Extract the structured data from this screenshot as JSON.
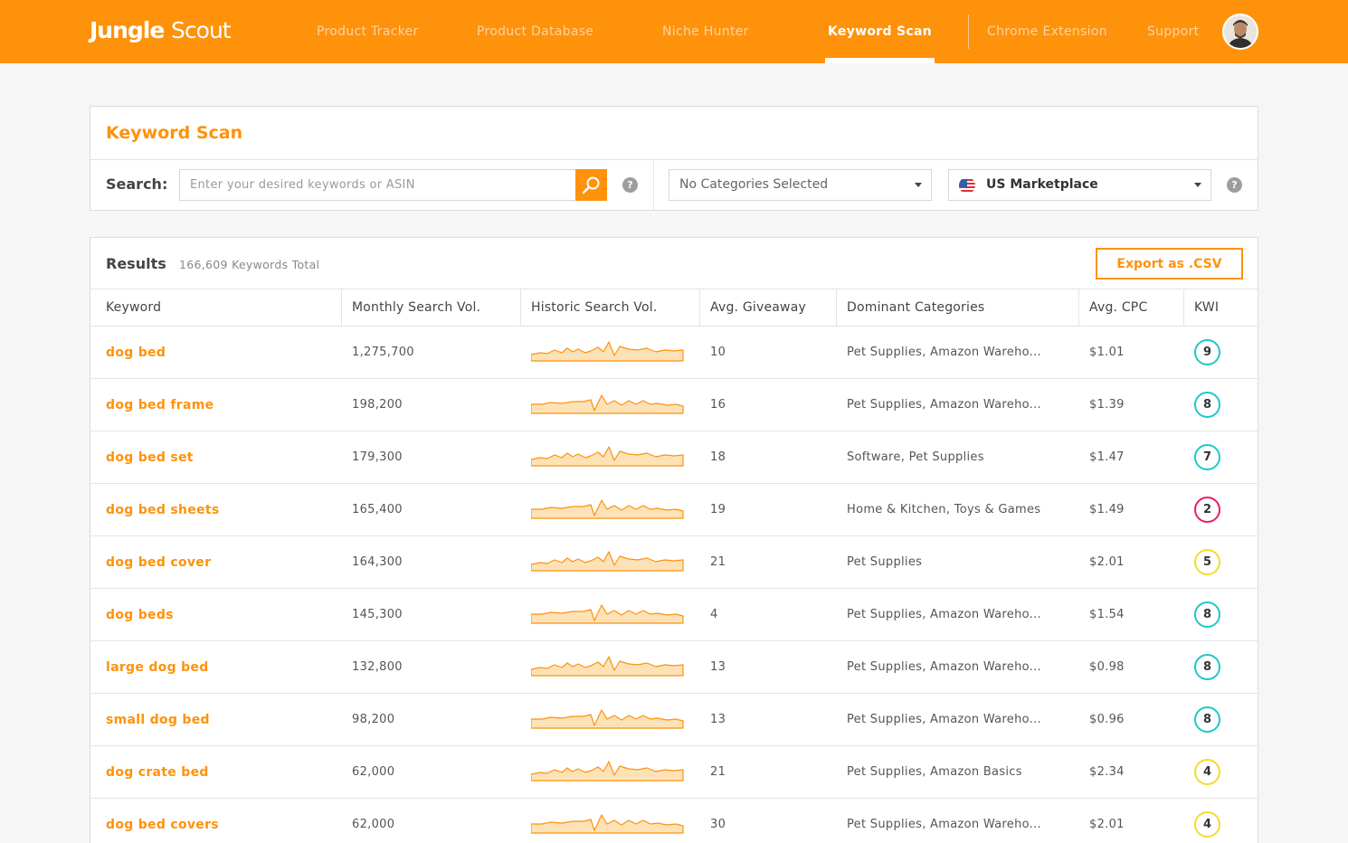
{
  "brand": {
    "logo_bold": "Jungle",
    "logo_light": "Scout"
  },
  "nav": {
    "items": [
      {
        "label": "Product Tracker",
        "active": false
      },
      {
        "label": "Product Database",
        "active": false
      },
      {
        "label": "Niche Hunter",
        "active": false
      },
      {
        "label": "Keyword Scan",
        "active": true
      },
      {
        "label": "Chrome Extension",
        "active": false
      },
      {
        "label": "Support",
        "active": false
      }
    ],
    "avatar_icon": "user-avatar"
  },
  "scan": {
    "title": "Keyword Scan",
    "search_label": "Search:",
    "search_placeholder": "Enter your desired keywords or ASIN",
    "search_icon": "magnifier-icon",
    "help_glyph": "?",
    "category_select": "No Categories Selected",
    "marketplace_select": "US Marketplace",
    "marketplace_flag": "us-flag-icon"
  },
  "results": {
    "label": "Results",
    "total": "166,609 Keywords Total",
    "export_label": "Export as .CSV",
    "columns": [
      "Keyword",
      "Monthly Search Vol.",
      "Historic Search Vol.",
      "Avg. Giveaway",
      "Dominant Categories",
      "Avg. CPC",
      "KWI"
    ],
    "rows": [
      {
        "keyword": "dog bed",
        "monthly": "1,275,700",
        "giveaway": "10",
        "categories": "Pet Supplies, Amazon Wareho...",
        "cpc": "$1.01",
        "kwi": "9",
        "kwi_color": "#1fc8c6",
        "trend": "a"
      },
      {
        "keyword": "dog bed frame",
        "monthly": "198,200",
        "giveaway": "16",
        "categories": "Pet Supplies, Amazon Wareho...",
        "cpc": "$1.39",
        "kwi": "8",
        "kwi_color": "#1fc8c6",
        "trend": "b"
      },
      {
        "keyword": "dog bed set",
        "monthly": "179,300",
        "giveaway": "18",
        "categories": "Software, Pet Supplies",
        "cpc": "$1.47",
        "kwi": "7",
        "kwi_color": "#1fc8c6",
        "trend": "a"
      },
      {
        "keyword": "dog bed sheets",
        "monthly": "165,400",
        "giveaway": "19",
        "categories": "Home & Kitchen, Toys & Games",
        "cpc": "$1.49",
        "kwi": "2",
        "kwi_color": "#e8215f",
        "trend": "b"
      },
      {
        "keyword": "dog bed cover",
        "monthly": "164,300",
        "giveaway": "21",
        "categories": "Pet Supplies",
        "cpc": "$2.01",
        "kwi": "5",
        "kwi_color": "#f3dc2c",
        "trend": "a"
      },
      {
        "keyword": "dog beds",
        "monthly": "145,300",
        "giveaway": "4",
        "categories": "Pet Supplies, Amazon Wareho...",
        "cpc": "$1.54",
        "kwi": "8",
        "kwi_color": "#1fc8c6",
        "trend": "b"
      },
      {
        "keyword": "large dog bed",
        "monthly": "132,800",
        "giveaway": "13",
        "categories": "Pet Supplies, Amazon Wareho...",
        "cpc": "$0.98",
        "kwi": "8",
        "kwi_color": "#1fc8c6",
        "trend": "a"
      },
      {
        "keyword": "small dog bed",
        "monthly": "98,200",
        "giveaway": "13",
        "categories": "Pet Supplies, Amazon Wareho...",
        "cpc": "$0.96",
        "kwi": "8",
        "kwi_color": "#1fc8c6",
        "trend": "b"
      },
      {
        "keyword": "dog crate bed",
        "monthly": "62,000",
        "giveaway": "21",
        "categories": "Pet Supplies, Amazon Basics",
        "cpc": "$2.34",
        "kwi": "4",
        "kwi_color": "#f3dc2c",
        "trend": "a"
      },
      {
        "keyword": "dog bed covers",
        "monthly": "62,000",
        "giveaway": "30",
        "categories": "Pet Supplies, Amazon Wareho...",
        "cpc": "$2.01",
        "kwi": "4",
        "kwi_color": "#f3dc2c",
        "trend": "b"
      }
    ]
  },
  "colors": {
    "accent": "#fe920a",
    "kwi_high": "#1fc8c6",
    "kwi_mid": "#f3dc2c",
    "kwi_low": "#e8215f"
  }
}
